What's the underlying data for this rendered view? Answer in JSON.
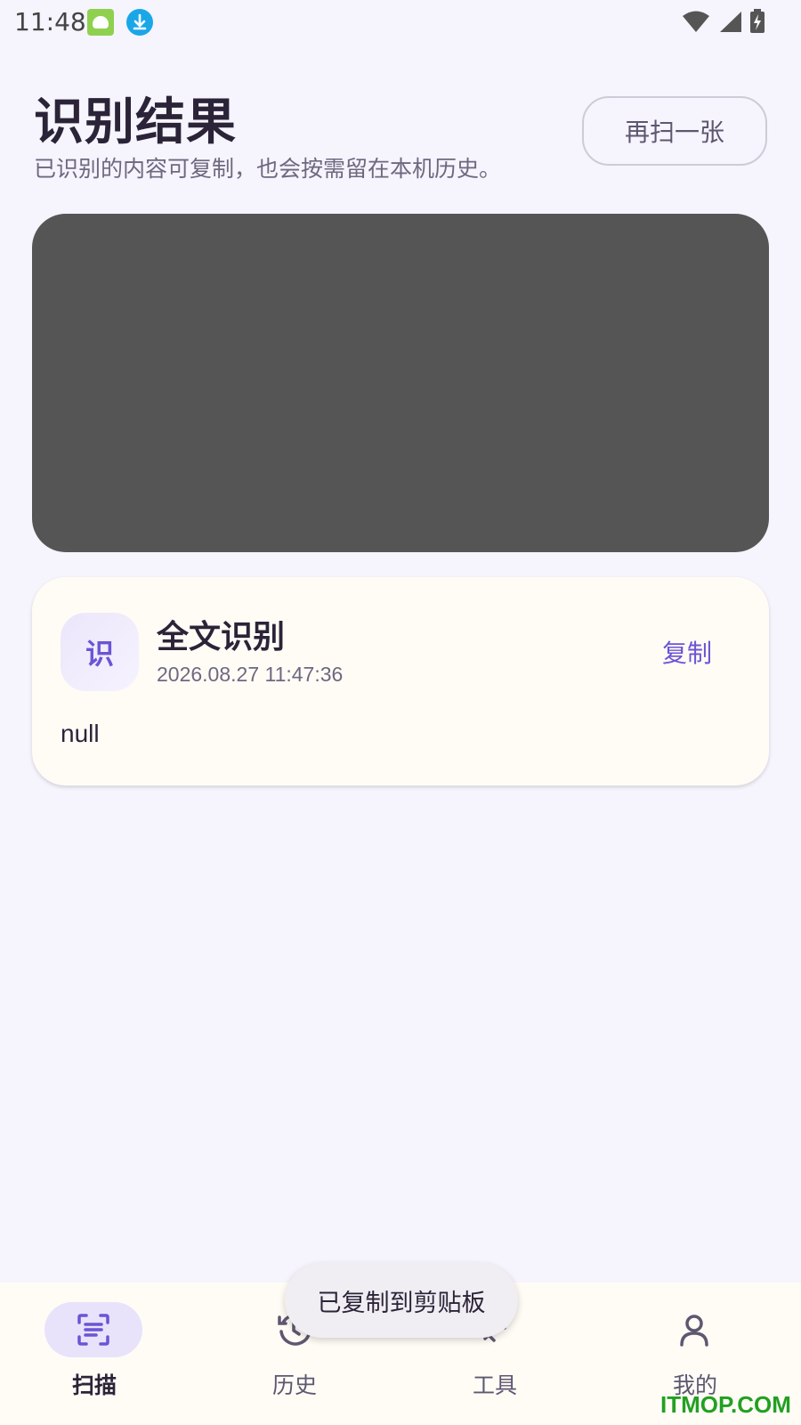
{
  "status_bar": {
    "time": "11:48"
  },
  "header": {
    "title": "识别结果",
    "subtitle": "已识别的内容可复制，也会按需留在本机历史。",
    "rescan_label": "再扫一张"
  },
  "result_card": {
    "badge": "识",
    "title": "全文识别",
    "timestamp": "2026.08.27 11:47:36",
    "copy_label": "复制",
    "content": "null"
  },
  "bottom_nav": {
    "items": [
      {
        "label": "扫描",
        "icon": "scan-text-icon",
        "active": true
      },
      {
        "label": "历史",
        "icon": "history-icon",
        "active": false
      },
      {
        "label": "工具",
        "icon": "tools-icon",
        "active": false
      },
      {
        "label": "我的",
        "icon": "profile-icon",
        "active": false
      }
    ]
  },
  "toast": "已复制到剪贴板",
  "watermark": "ITMOP.COM",
  "colors": {
    "accent": "#6b55d4",
    "background": "#f6f4fc",
    "card": "#fffcf6",
    "preview": "#555555"
  }
}
